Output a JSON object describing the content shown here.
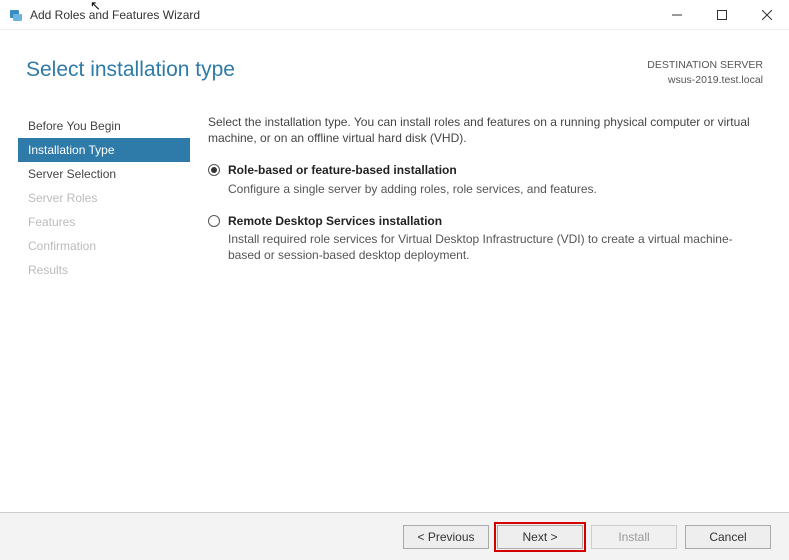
{
  "window": {
    "title": "Add Roles and Features Wizard"
  },
  "header": {
    "title": "Select installation type",
    "destination_label": "DESTINATION SERVER",
    "destination_server": "wsus-2019.test.local"
  },
  "nav": {
    "items": [
      {
        "label": "Before You Begin",
        "selected": false,
        "disabled": false
      },
      {
        "label": "Installation Type",
        "selected": true,
        "disabled": false
      },
      {
        "label": "Server Selection",
        "selected": false,
        "disabled": false
      },
      {
        "label": "Server Roles",
        "selected": false,
        "disabled": true
      },
      {
        "label": "Features",
        "selected": false,
        "disabled": true
      },
      {
        "label": "Confirmation",
        "selected": false,
        "disabled": true
      },
      {
        "label": "Results",
        "selected": false,
        "disabled": true
      }
    ]
  },
  "main": {
    "intro": "Select the installation type. You can install roles and features on a running physical computer or virtual machine, or on an offline virtual hard disk (VHD).",
    "options": [
      {
        "title": "Role-based or feature-based installation",
        "desc": "Configure a single server by adding roles, role services, and features.",
        "checked": true
      },
      {
        "title": "Remote Desktop Services installation",
        "desc": "Install required role services for Virtual Desktop Infrastructure (VDI) to create a virtual machine-based or session-based desktop deployment.",
        "checked": false
      }
    ]
  },
  "footer": {
    "previous": "< Previous",
    "next": "Next >",
    "install": "Install",
    "cancel": "Cancel"
  }
}
